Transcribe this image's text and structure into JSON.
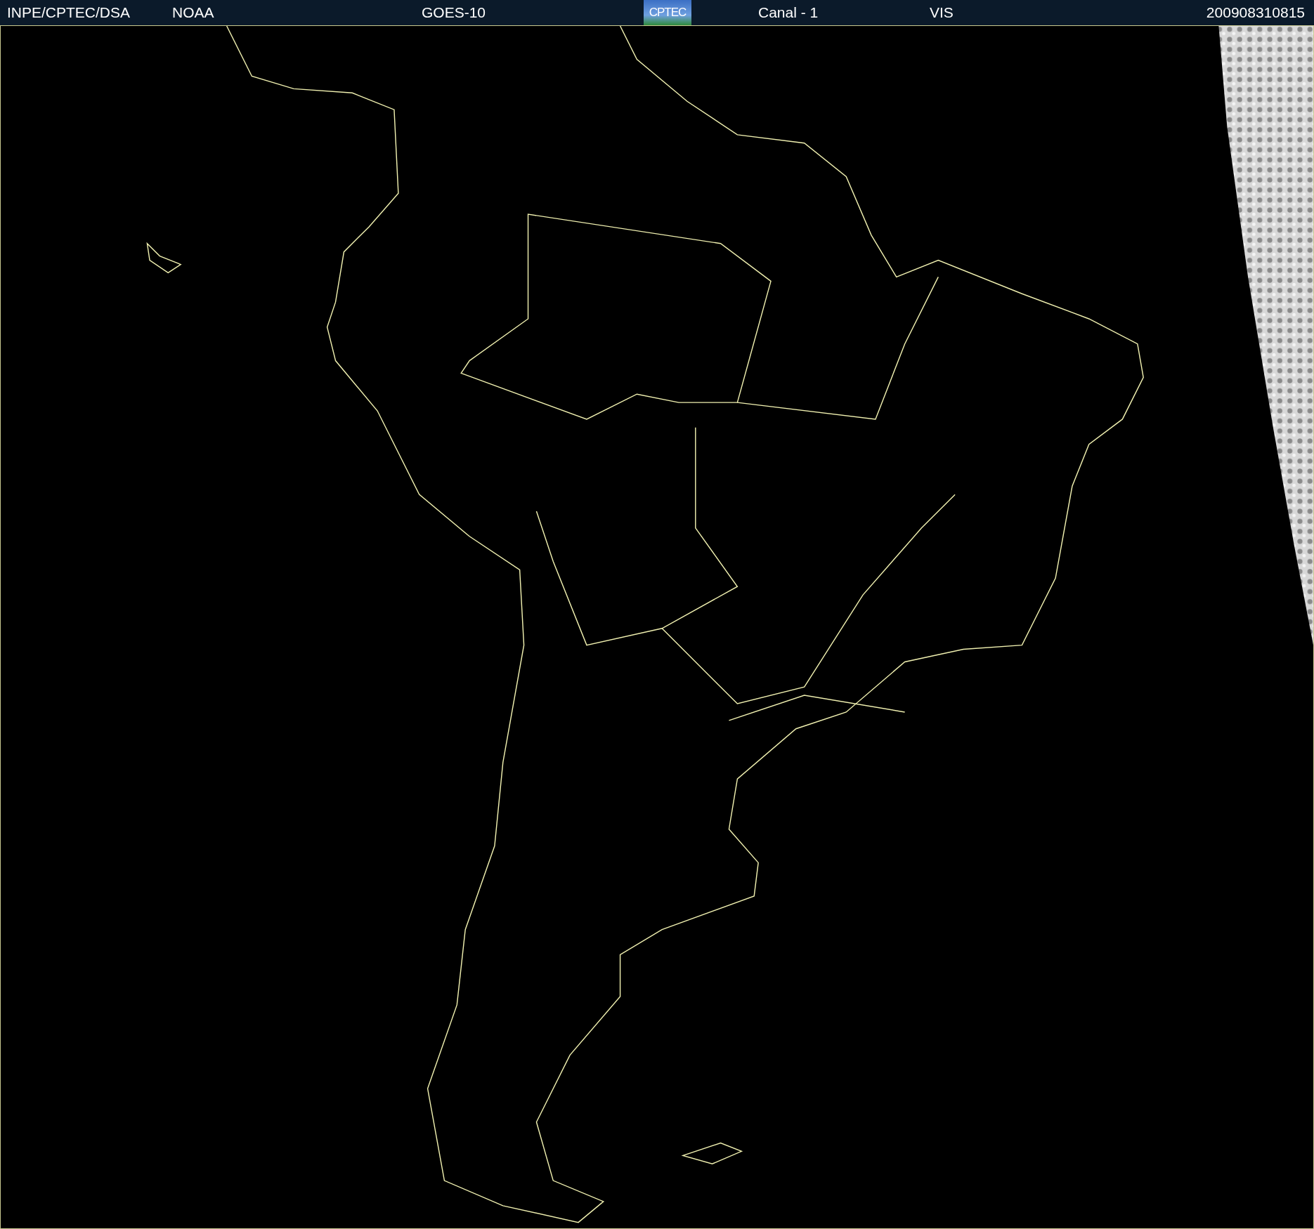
{
  "header": {
    "agency": "INPE/CPTEC/DSA",
    "source": "NOAA",
    "satellite": "GOES-10",
    "logo_text": "CPTEC",
    "channel": "Canal - 1",
    "band": "VIS",
    "timestamp": "200908310815"
  }
}
